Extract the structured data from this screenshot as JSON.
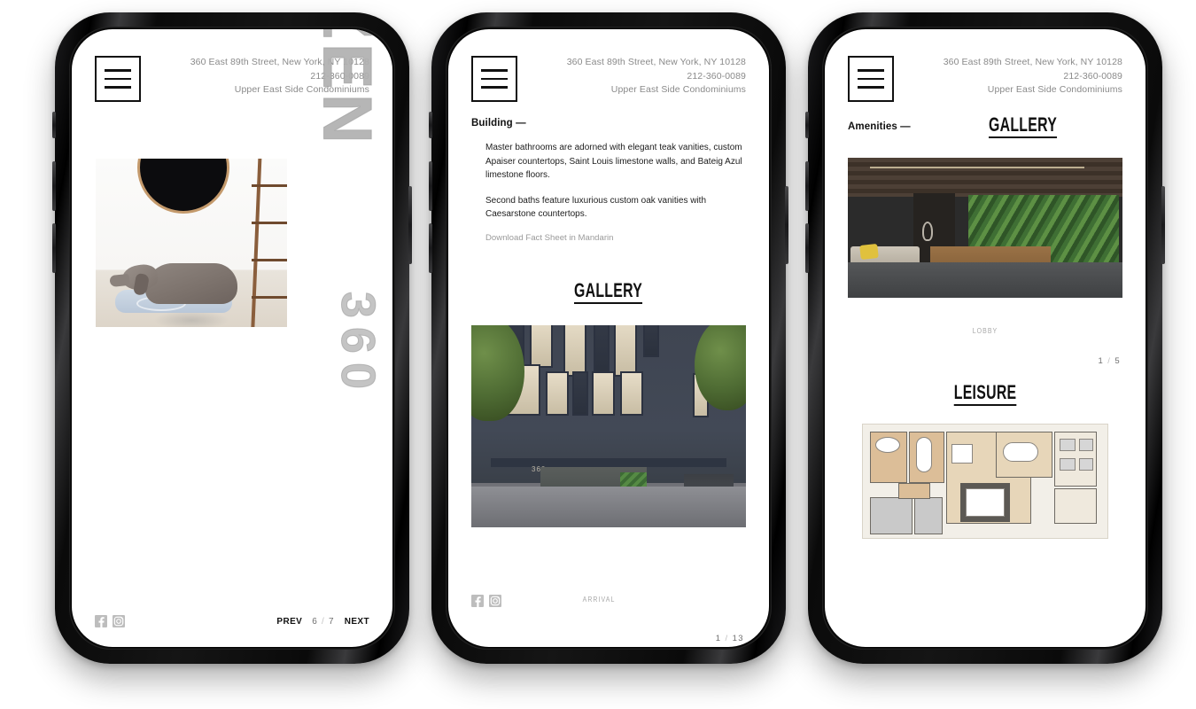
{
  "site": {
    "address_line1": "360 East 89th Street, New York, NY 10128",
    "phone": "212-360-0089",
    "tagline": "Upper East Side Condominiums",
    "menu_icon": "hamburger-menu-icon",
    "brand_wordmark": "CITIZEN",
    "brand_wordmark_secondary": "360",
    "accent_color": "#111111",
    "muted_color": "#8a8a8a"
  },
  "social": {
    "facebook_label": "Facebook",
    "instagram_label": "Instagram"
  },
  "phone1": {
    "screen_name": "residences-hero",
    "nav": {
      "prev_label": "PREV",
      "next_label": "NEXT",
      "current": "6",
      "slash": "/",
      "total": "7"
    },
    "artwork_alt": "Weimaraner dog resting on a blue cushion beside a wooden ladder and round black mirror"
  },
  "phone2": {
    "screen_name": "building-detail",
    "section_label": "Building —",
    "paragraphs": [
      "Master bathrooms are adorned with elegant teak vanities, custom Apaiser countertops, Saint Louis limestone walls, and Bateig Azul limestone floors.",
      "Second baths feature luxurious custom oak vanities with Caesarstone countertops."
    ],
    "download_link": "Download Fact Sheet in Mandarin",
    "gallery_heading": "GALLERY",
    "image_caption": "ARRIVAL",
    "counter": {
      "current": "1",
      "slash": "/",
      "total": "13"
    },
    "artwork_alt": "Dark stone building facade at dusk with lit windows, street trees and glass lobby entrance"
  },
  "phone3": {
    "screen_name": "amenities-gallery",
    "section_label": "Amenities —",
    "gallery_heading": "GALLERY",
    "image_caption": "LOBBY",
    "counter": {
      "current": "1",
      "slash": "/",
      "total": "5"
    },
    "second_heading": "LEISURE",
    "artwork_alt_lobby": "Lobby interior with living green wall, wood reception desk and lounge seating",
    "artwork_alt_plan": "Amenity level architectural floor plan in tan and grey"
  }
}
